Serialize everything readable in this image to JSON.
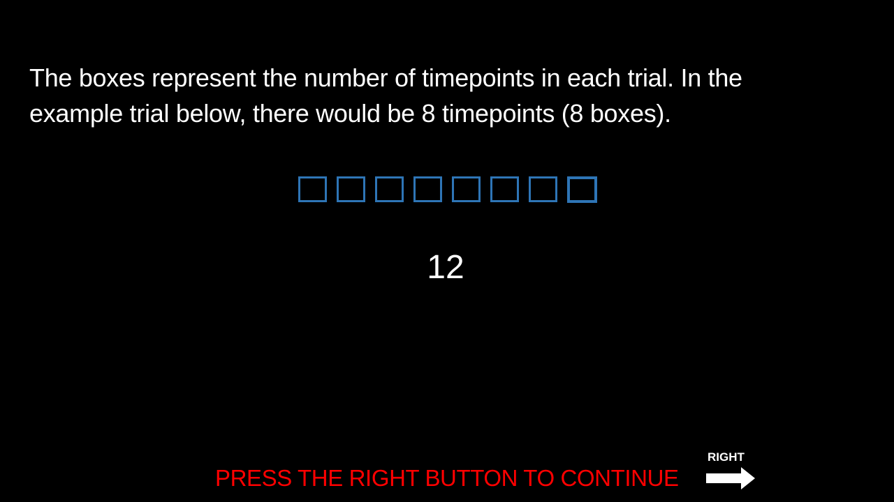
{
  "instructions": {
    "line1": "The boxes represent the number of timepoints in each trial. In the",
    "line2": "example trial below, there would be 8 timepoints (8 boxes)."
  },
  "trial": {
    "box_count": 8,
    "box_color": "#2e75b6",
    "counter": "12"
  },
  "footer": {
    "prompt": "PRESS THE RIGHT BUTTON TO CONTINUE",
    "prompt_color": "#ff0000",
    "key_label": "RIGHT",
    "key_icon": "right-arrow-icon"
  }
}
